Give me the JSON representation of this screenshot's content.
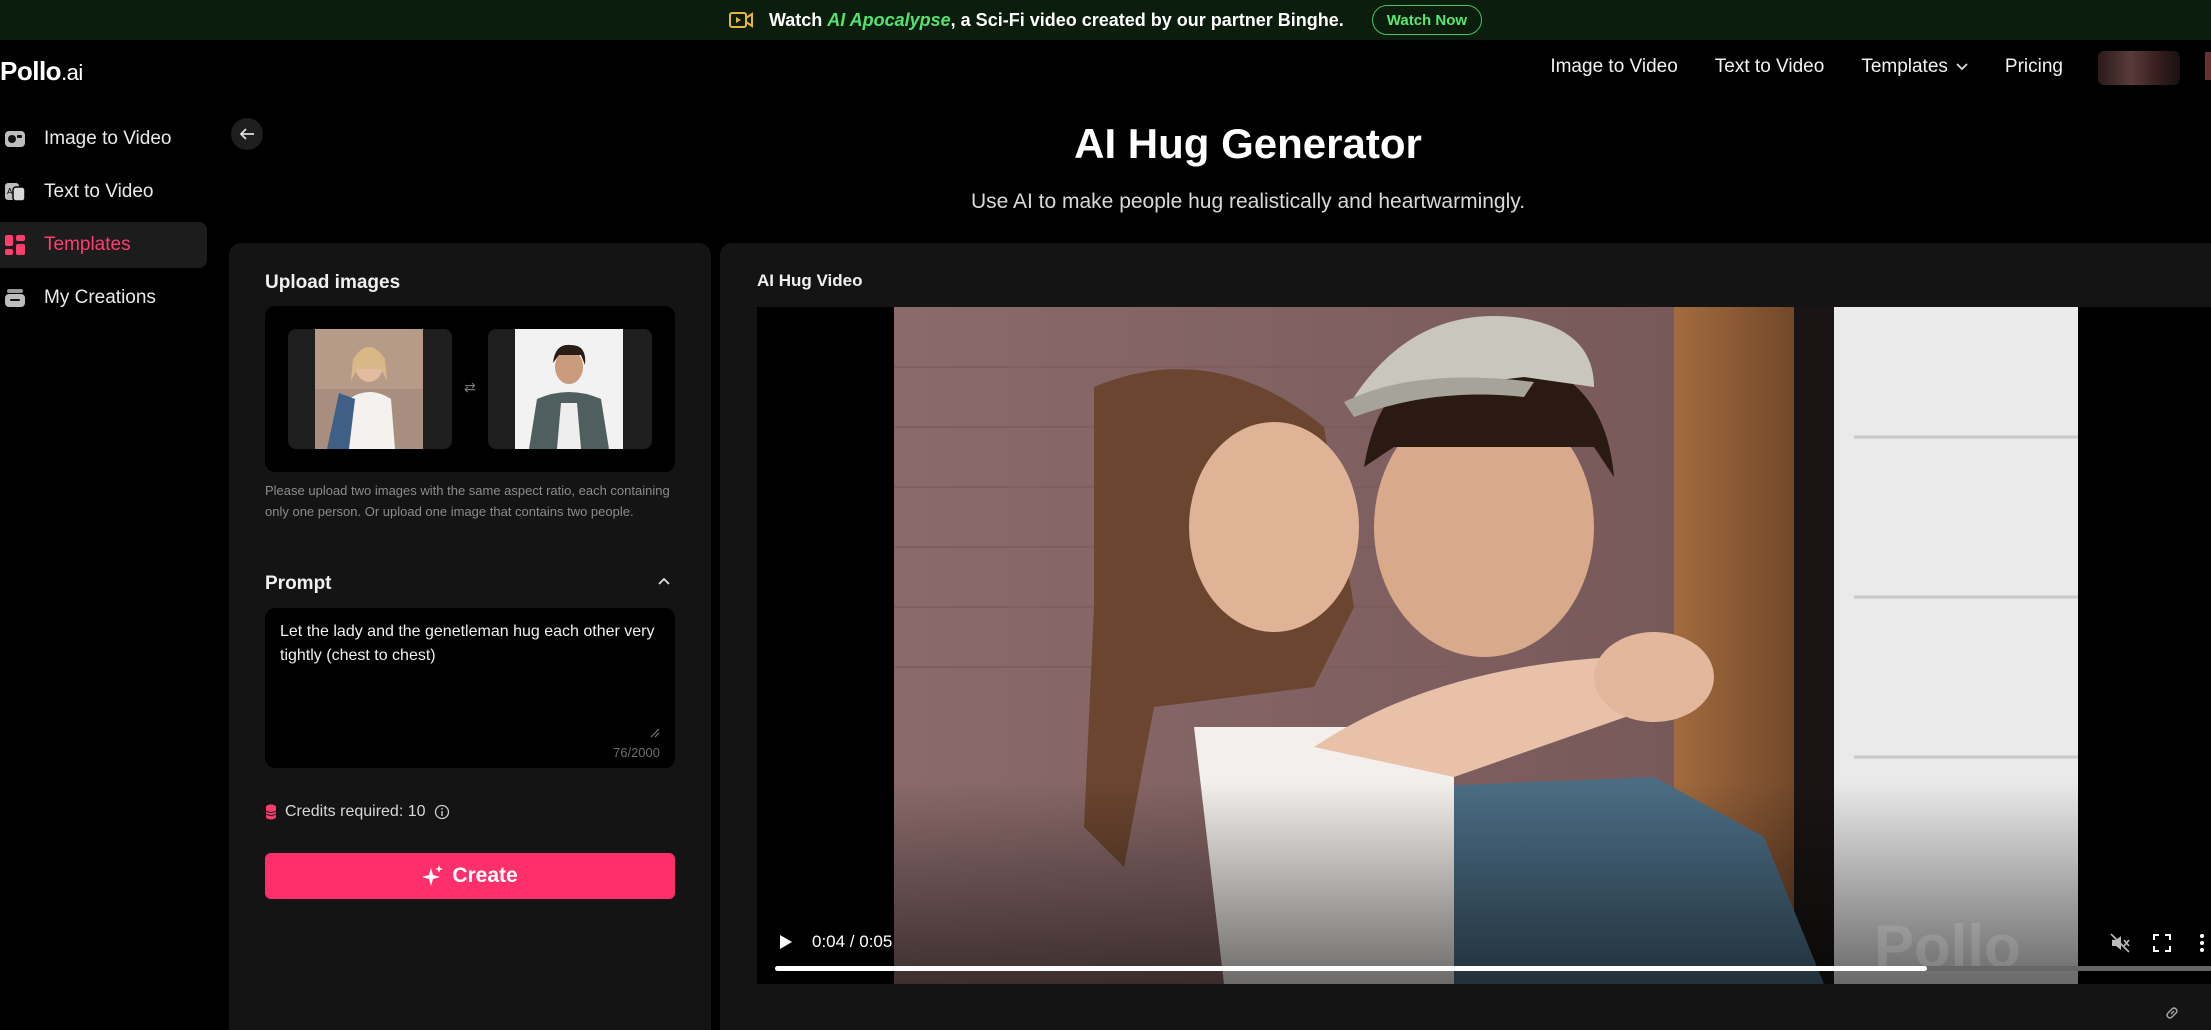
{
  "banner": {
    "prefix": "Watch",
    "highlight": "AI Apocalypse",
    "suffix": ", a Sci-Fi video created by our partner Binghe.",
    "button": "Watch Now",
    "icon": "video-icon"
  },
  "header": {
    "logo_main": "Pollo",
    "logo_suffix": ".ai",
    "nav": [
      {
        "label": "Image to Video"
      },
      {
        "label": "Text to Video"
      },
      {
        "label": "Templates",
        "icon": "chevron-down-icon"
      },
      {
        "label": "Pricing"
      }
    ]
  },
  "sidebar": {
    "items": [
      {
        "label": "Image to Video",
        "icon": "image-video-icon"
      },
      {
        "label": "Text to Video",
        "icon": "text-video-icon"
      },
      {
        "label": "Templates",
        "icon": "templates-icon",
        "active": true
      },
      {
        "label": "My Creations",
        "icon": "creations-icon"
      }
    ]
  },
  "page": {
    "title": "AI Hug Generator",
    "subtitle": "Use AI to make people hug realistically and heartwarmingly."
  },
  "form": {
    "upload_label": "Upload images",
    "swap_icon": "swap-icon",
    "hint": "Please upload two images with the same aspect ratio, each containing only one person. Or upload one image that contains two people.",
    "prompt_label": "Prompt",
    "prompt_value": "Let the lady and the genetleman hug each other very tightly (chest to chest)",
    "prompt_counter": "76/2000",
    "credits_label": "Credits required: 10",
    "create_label": "Create"
  },
  "result": {
    "label": "AI Hug Video",
    "time": "0:04 / 0:05",
    "progress": 0.8,
    "watermark": "Pollo"
  },
  "colors": {
    "accent": "#ff2f6b",
    "banner_bg": "#0b1d0c",
    "banner_green": "#54e26f",
    "panel_bg": "#141414"
  }
}
